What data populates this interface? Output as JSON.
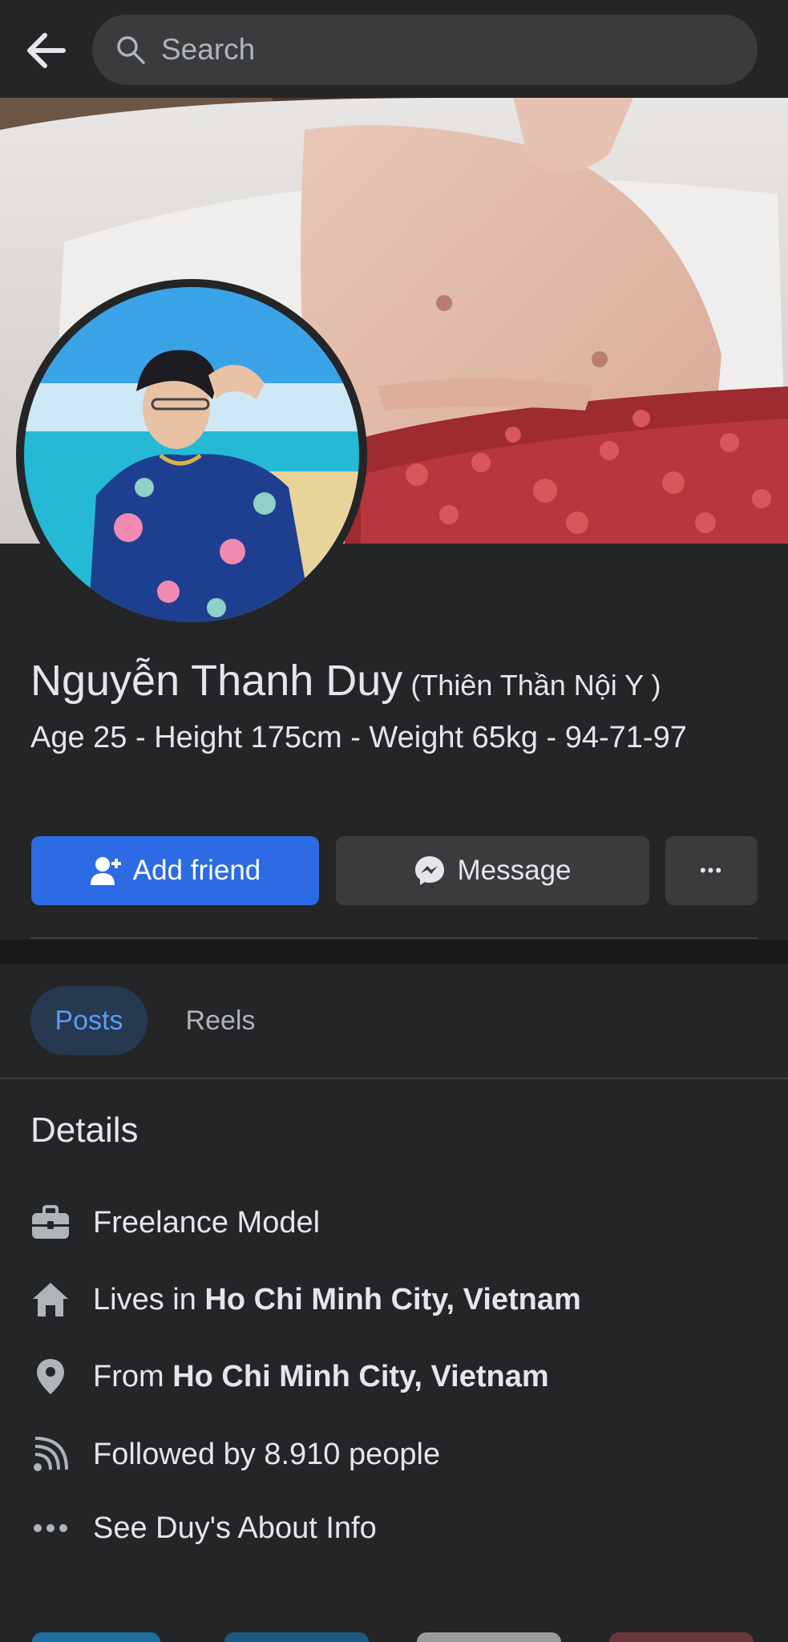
{
  "search": {
    "placeholder": "Search"
  },
  "profile": {
    "name": "Nguyễn Thanh Duy",
    "nickname": "(Thiên Thần Nội Y )",
    "bio": "Age 25 - Height 175cm - Weight 65kg  - 94-71-97"
  },
  "actions": {
    "add_friend": "Add friend",
    "message": "Message",
    "more": "•••"
  },
  "tabs": [
    {
      "label": "Posts",
      "active": true
    },
    {
      "label": "Reels",
      "active": false
    }
  ],
  "details": {
    "title": "Details",
    "work": "Freelance Model",
    "lives_prefix": "Lives in ",
    "lives_place": "Ho Chi Minh City, Vietnam",
    "from_prefix": "From ",
    "from_place": "Ho Chi Minh City, Vietnam",
    "followers": "Followed by 8.910 people",
    "about": "See Duy's About Info"
  },
  "icons": {
    "back": "arrow-left-icon",
    "search": "magnifier-icon",
    "add_friend": "user-plus-icon",
    "message": "messenger-icon",
    "work": "briefcase-icon",
    "home": "house-icon",
    "location": "map-pin-icon",
    "followers": "rss-icon",
    "about": "ellipsis-icon"
  },
  "colors": {
    "background": "#242526",
    "primary": "#2d6be4",
    "tab_active_bg": "#263951",
    "tab_active_text": "#5a9cf5"
  }
}
